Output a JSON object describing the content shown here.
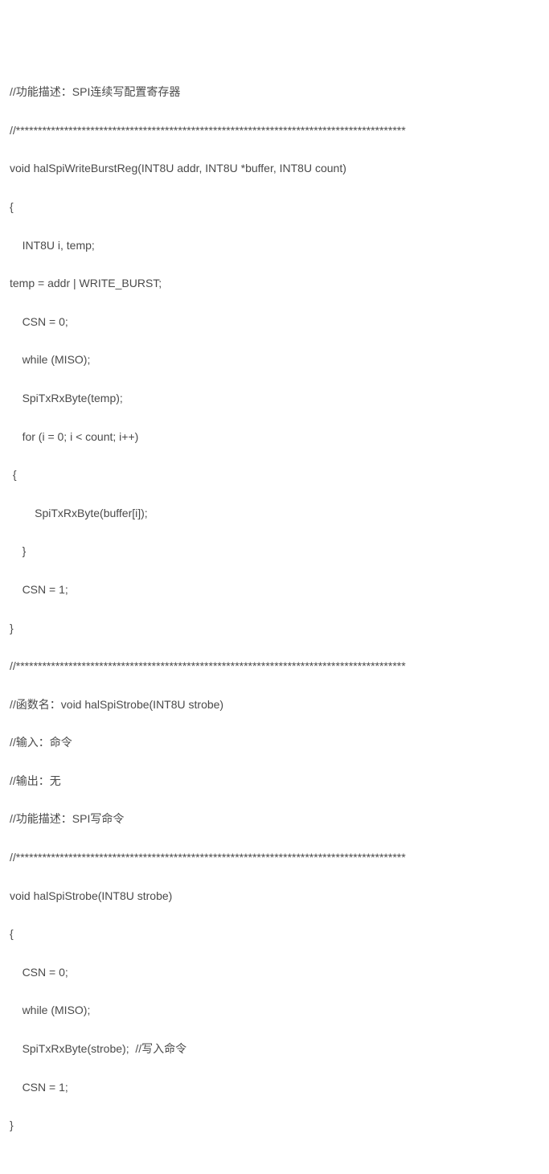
{
  "code": {
    "lines": [
      "//功能描述：SPI连续写配置寄存器",
      "//*****************************************************************************************",
      "void halSpiWriteBurstReg(INT8U addr, INT8U *buffer, INT8U count)",
      "{",
      "    INT8U i, temp;",
      "temp = addr | WRITE_BURST;",
      "    CSN = 0;",
      "    while (MISO);",
      "    SpiTxRxByte(temp);",
      "    for (i = 0; i < count; i++)",
      " {",
      "        SpiTxRxByte(buffer[i]);",
      "    }",
      "    CSN = 1;",
      "}",
      "//*****************************************************************************************",
      "//函数名：void halSpiStrobe(INT8U strobe)",
      "//输入：命令",
      "//输出：无",
      "//功能描述：SPI写命令",
      "//*****************************************************************************************",
      "void halSpiStrobe(INT8U strobe)",
      "{",
      "    CSN = 0;",
      "    while (MISO);",
      "    SpiTxRxByte(strobe);  //写入命令",
      "    CSN = 1;",
      "}"
    ]
  }
}
